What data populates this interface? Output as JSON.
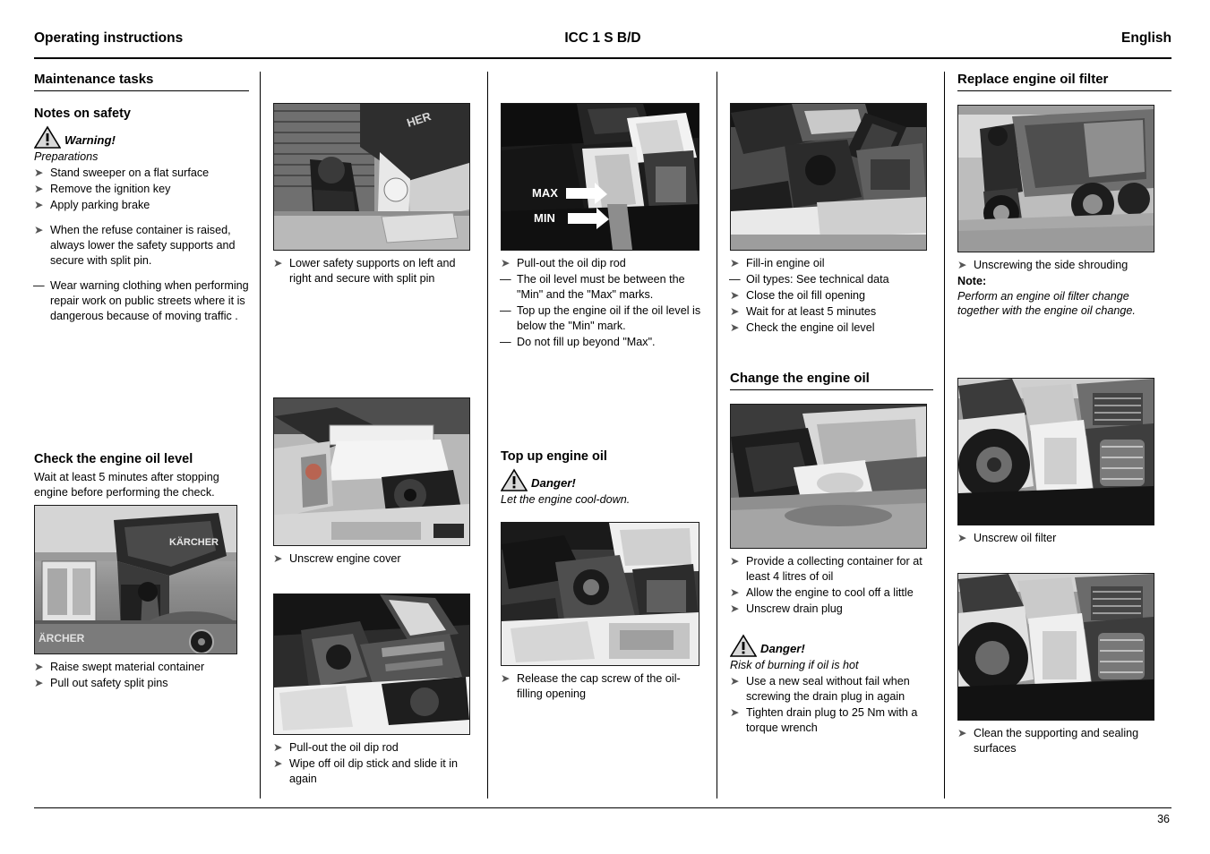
{
  "header": {
    "left": "Operating instructions",
    "center": "ICC 1 S B/D",
    "right": "English"
  },
  "footer": {
    "page_number": "36"
  },
  "columns": {
    "col1": {
      "section_title": "Maintenance tasks",
      "safety_heading": "Notes on safety",
      "warning_word": "Warning!",
      "preparations_label": "Preparations",
      "prep_steps": [
        "Stand sweeper on a flat surface",
        "Remove the ignition key",
        "Apply parking brake"
      ],
      "container_step": "When the refuse container is raised, always lower the safety supports and secure with split pin.",
      "clothing_note": "Wear warning clothing when performing repair work on public streets where it is dangerous because of moving traffic .",
      "check_oil_heading": "Check the engine oil level",
      "check_oil_body": "Wait at least 5 minutes after stopping engine before performing the check.",
      "photo_caption_steps": [
        "Raise swept material container",
        "Pull out safety split pins"
      ]
    },
    "col2": {
      "caption_1": "Lower safety supports on left and right and secure with split pin",
      "caption_2": "Unscrew engine cover",
      "caption_3a": "Pull-out the oil dip rod",
      "caption_3b": "Wipe off oil dip stick and slide it in again"
    },
    "col3": {
      "dipstick_step": "Pull-out the oil dip rod",
      "dipstick_dashes": [
        "The oil level must be between the \"Min\" and the \"Max\" marks.",
        "Top up the engine oil if the oil level is below the \"Min\" mark.",
        "Do not fill up beyond \"Max\"."
      ],
      "photo_labels": {
        "max": "MAX",
        "min": "MIN"
      },
      "topup_heading": "Top up engine oil",
      "danger_word": "Danger!",
      "danger_body": "Let the engine cool-down.",
      "caption_last": "Release the cap screw of the oil-filling opening"
    },
    "col4": {
      "fill_steps": [
        {
          "type": "arrow",
          "text": "Fill-in engine oil"
        },
        {
          "type": "dash",
          "text": "Oil types: See technical data"
        },
        {
          "type": "arrow",
          "text": "Close the oil fill opening"
        },
        {
          "type": "arrow",
          "text": "Wait for at least 5 minutes"
        },
        {
          "type": "arrow",
          "text": "Check the engine oil level"
        }
      ],
      "change_heading": "Change the engine oil",
      "change_steps": [
        "Provide a collecting container for at least 4 litres of oil",
        "Allow the engine to cool off a little",
        "Unscrew drain plug"
      ],
      "danger_word": "Danger!",
      "danger_body": "Risk of burning if oil is hot",
      "danger_steps": [
        "Use a new seal without fail when screwing the drain plug in again",
        "Tighten drain plug to 25 Nm with a torque wrench"
      ]
    },
    "col5": {
      "replace_heading": "Replace engine oil filter",
      "caption_1": "Unscrewing the side shrouding",
      "note_label": "Note:",
      "note_body": "Perform an engine oil filter change together with the engine oil change.",
      "caption_2": "Unscrew oil filter",
      "caption_3": "Clean the supporting and sealing surfaces"
    }
  },
  "markers": {
    "arrow": "➤",
    "dash": "—"
  }
}
